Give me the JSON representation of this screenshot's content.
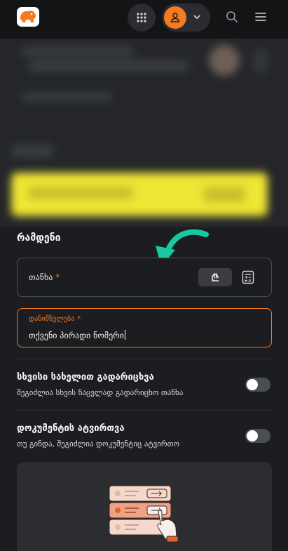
{
  "header": {
    "logo_icon": "lion-logo-icon",
    "apps_icon": "apps-grid-icon",
    "avatar_icon": "user-icon",
    "dropdown_icon": "chevron-down-icon",
    "search_icon": "search-icon",
    "menu_icon": "hamburger-menu-icon"
  },
  "form": {
    "section_title": "რამდენი",
    "amount": {
      "label": "თანხა",
      "required_mark": "*",
      "currency_icon": "lari-icon",
      "calculator_icon": "calculator-icon"
    },
    "personal_id": {
      "label": "დანიშნულება",
      "required_mark": "*",
      "value": "თქვენი პირადი ნომერი"
    }
  },
  "options": [
    {
      "title": "სხვისი სახელით გადარიცხვა",
      "description": "შეგიძლია სხვის ნაცვლად გადარიცხო თანხა",
      "enabled": false
    },
    {
      "title": "დოკუმენტის ატვირთვა",
      "description": "თუ გინდა, შეგიძლია დოკუმენტიც ატვირთო",
      "enabled": false
    }
  ],
  "colors": {
    "accent": "#f47b20",
    "background": "#1c1d20",
    "highlight_arrow": "#19c7a0"
  }
}
